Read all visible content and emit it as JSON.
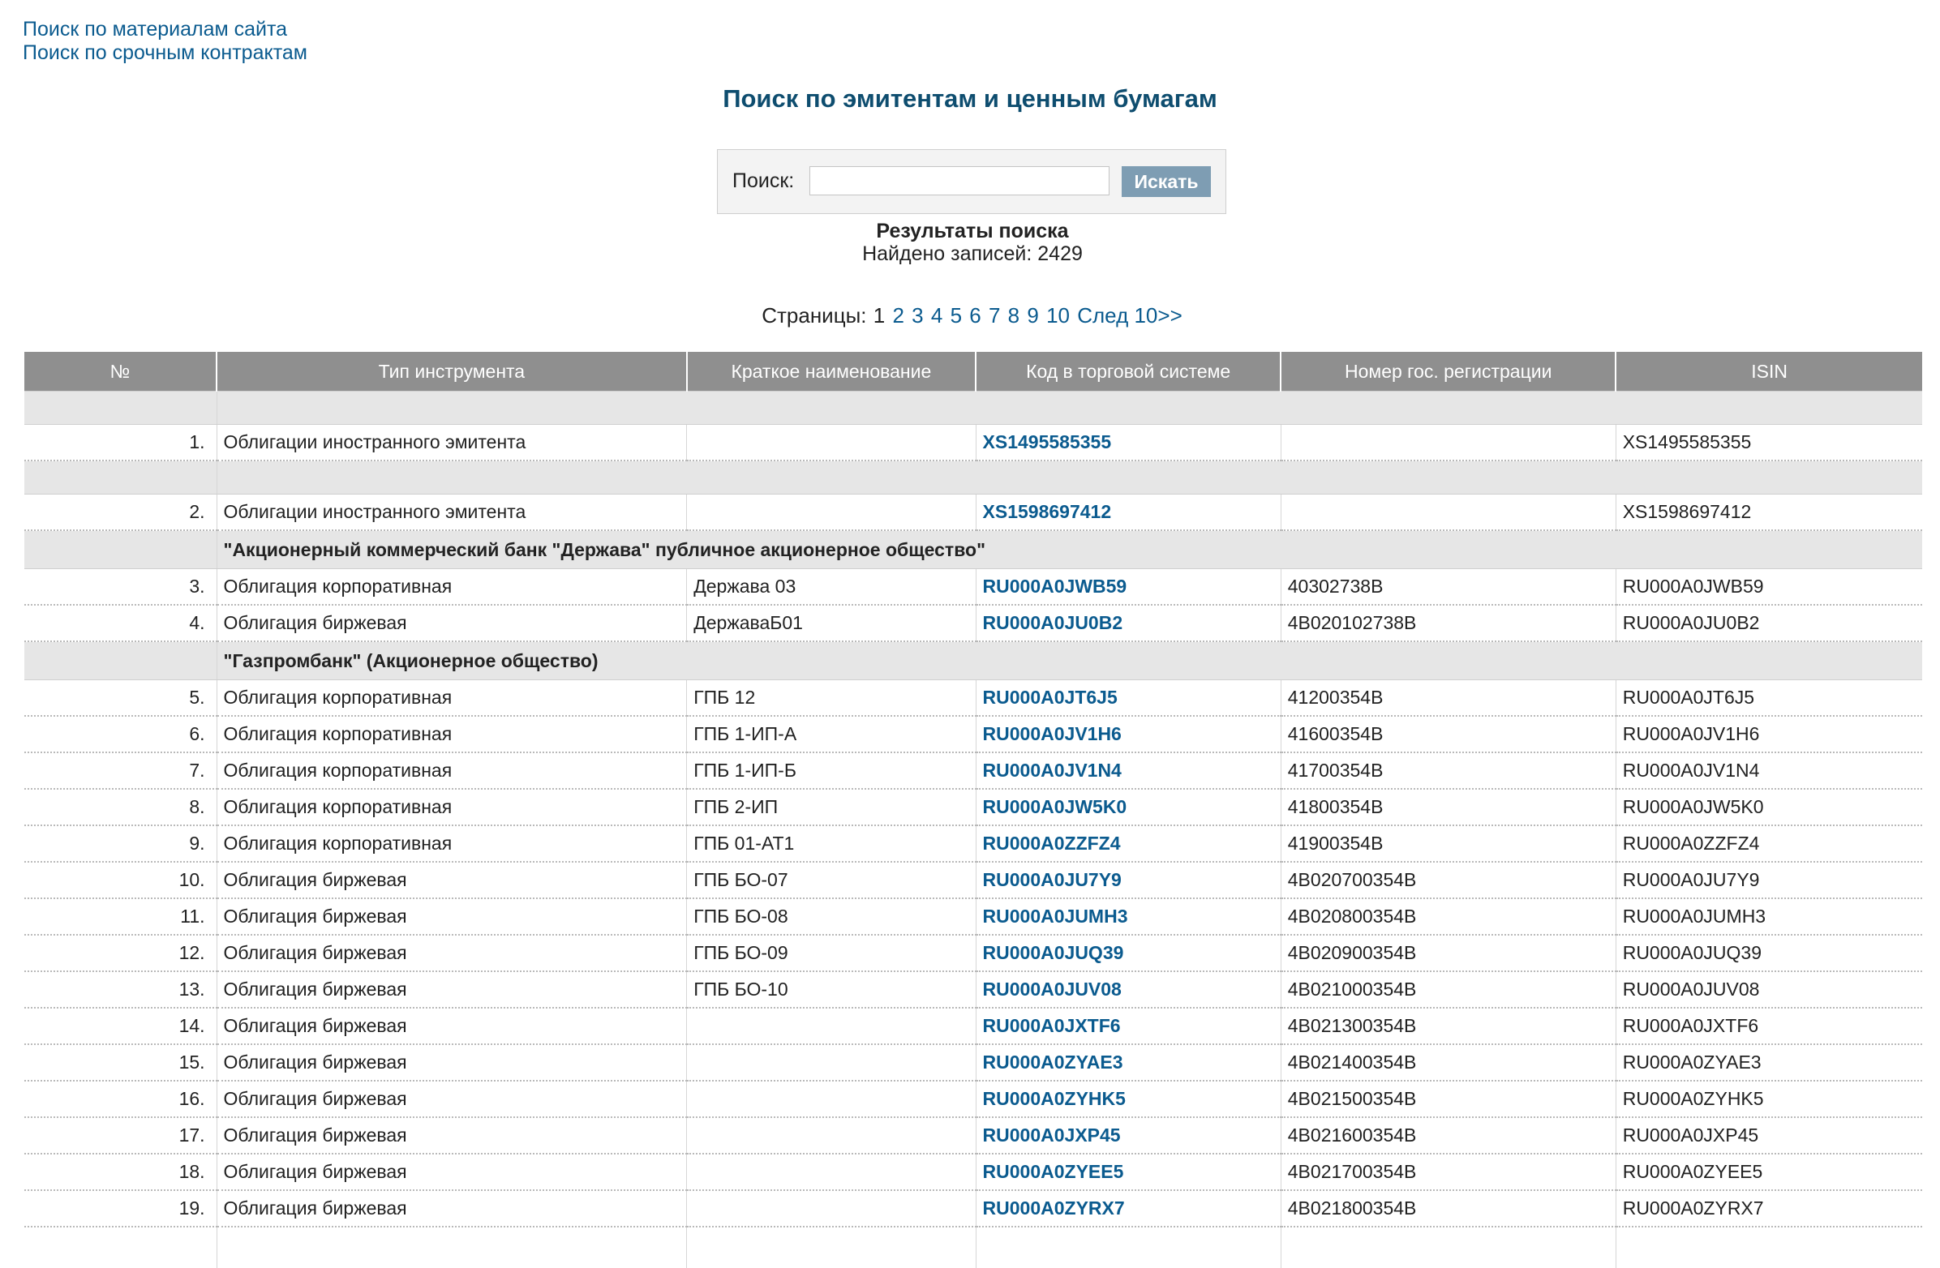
{
  "top_links": [
    "Поиск по материалам сайта",
    "Поиск по срочным контрактам"
  ],
  "page_title": "Поиск по эмитентам и ценным бумагам",
  "search": {
    "label": "Поиск:",
    "value": "",
    "placeholder": "",
    "button": "Искать"
  },
  "results": {
    "title": "Результаты поиска",
    "count_text": "Найдено записей: 2429"
  },
  "pagination": {
    "label": "Страницы:",
    "pages": [
      "1",
      "2",
      "3",
      "4",
      "5",
      "6",
      "7",
      "8",
      "9",
      "10"
    ],
    "current": "1",
    "next": "След 10>>"
  },
  "colors": {
    "link": "#0b5b8f",
    "header_bg": "#8f8f8f",
    "group_bg": "#e6e6e6",
    "button_bg": "#7e9db3"
  },
  "table": {
    "columns": [
      "№",
      "Тип инструмента",
      "Краткое наименование",
      "Код в торговой системе",
      "Номер гос. регистрации",
      "ISIN"
    ],
    "rows": [
      {
        "kind": "group",
        "title": ""
      },
      {
        "kind": "item",
        "num": "1.",
        "type": "Облигации иностранного эмитента",
        "short": "",
        "code": "XS1495585355",
        "reg": "",
        "isin": "XS1495585355"
      },
      {
        "kind": "group",
        "title": ""
      },
      {
        "kind": "item",
        "num": "2.",
        "type": "Облигации иностранного эмитента",
        "short": "",
        "code": "XS1598697412",
        "reg": "",
        "isin": "XS1598697412"
      },
      {
        "kind": "group",
        "title": "\"Акционерный коммерческий банк \"Держава\" публичное акционерное общество\""
      },
      {
        "kind": "item",
        "num": "3.",
        "type": "Облигация корпоративная",
        "short": "Держава 03",
        "code": "RU000A0JWB59",
        "reg": "40302738B",
        "isin": "RU000A0JWB59"
      },
      {
        "kind": "item",
        "num": "4.",
        "type": "Облигация биржевая",
        "short": "ДержаваБ01",
        "code": "RU000A0JU0B2",
        "reg": "4B020102738B",
        "isin": "RU000A0JU0B2"
      },
      {
        "kind": "group",
        "title": "\"Газпромбанк\" (Акционерное общество)"
      },
      {
        "kind": "item",
        "num": "5.",
        "type": "Облигация корпоративная",
        "short": "ГПБ 12",
        "code": "RU000A0JT6J5",
        "reg": "41200354B",
        "isin": "RU000A0JT6J5"
      },
      {
        "kind": "item",
        "num": "6.",
        "type": "Облигация корпоративная",
        "short": "ГПБ 1-ИП-А",
        "code": "RU000A0JV1H6",
        "reg": "41600354B",
        "isin": "RU000A0JV1H6"
      },
      {
        "kind": "item",
        "num": "7.",
        "type": "Облигация корпоративная",
        "short": "ГПБ 1-ИП-Б",
        "code": "RU000A0JV1N4",
        "reg": "41700354B",
        "isin": "RU000A0JV1N4"
      },
      {
        "kind": "item",
        "num": "8.",
        "type": "Облигация корпоративная",
        "short": "ГПБ 2-ИП",
        "code": "RU000A0JW5K0",
        "reg": "41800354B",
        "isin": "RU000A0JW5K0"
      },
      {
        "kind": "item",
        "num": "9.",
        "type": "Облигация корпоративная",
        "short": "ГПБ 01-АТ1",
        "code": "RU000A0ZZFZ4",
        "reg": "41900354B",
        "isin": "RU000A0ZZFZ4"
      },
      {
        "kind": "item",
        "num": "10.",
        "type": "Облигация биржевая",
        "short": "ГПБ БО-07",
        "code": "RU000A0JU7Y9",
        "reg": "4B020700354B",
        "isin": "RU000A0JU7Y9"
      },
      {
        "kind": "item",
        "num": "11.",
        "type": "Облигация биржевая",
        "short": "ГПБ БО-08",
        "code": "RU000A0JUMH3",
        "reg": "4B020800354B",
        "isin": "RU000A0JUMH3"
      },
      {
        "kind": "item",
        "num": "12.",
        "type": "Облигация биржевая",
        "short": "ГПБ БО-09",
        "code": "RU000A0JUQ39",
        "reg": "4B020900354B",
        "isin": "RU000A0JUQ39"
      },
      {
        "kind": "item",
        "num": "13.",
        "type": "Облигация биржевая",
        "short": "ГПБ БО-10",
        "code": "RU000A0JUV08",
        "reg": "4B021000354B",
        "isin": "RU000A0JUV08"
      },
      {
        "kind": "item",
        "num": "14.",
        "type": "Облигация биржевая",
        "short": "",
        "code": "RU000A0JXTF6",
        "reg": "4B021300354B",
        "isin": "RU000A0JXTF6"
      },
      {
        "kind": "item",
        "num": "15.",
        "type": "Облигация биржевая",
        "short": "",
        "code": "RU000A0ZYAE3",
        "reg": "4B021400354B",
        "isin": "RU000A0ZYAE3"
      },
      {
        "kind": "item",
        "num": "16.",
        "type": "Облигация биржевая",
        "short": "",
        "code": "RU000A0ZYHK5",
        "reg": "4B021500354B",
        "isin": "RU000A0ZYHK5"
      },
      {
        "kind": "item",
        "num": "17.",
        "type": "Облигация биржевая",
        "short": "",
        "code": "RU000A0JXP45",
        "reg": "4B021600354B",
        "isin": "RU000A0JXP45"
      },
      {
        "kind": "item",
        "num": "18.",
        "type": "Облигация биржевая",
        "short": "",
        "code": "RU000A0ZYEE5",
        "reg": "4B021700354B",
        "isin": "RU000A0ZYEE5"
      },
      {
        "kind": "item",
        "num": "19.",
        "type": "Облигация биржевая",
        "short": "",
        "code": "RU000A0ZYRX7",
        "reg": "4B021800354B",
        "isin": "RU000A0ZYRX7"
      }
    ]
  }
}
